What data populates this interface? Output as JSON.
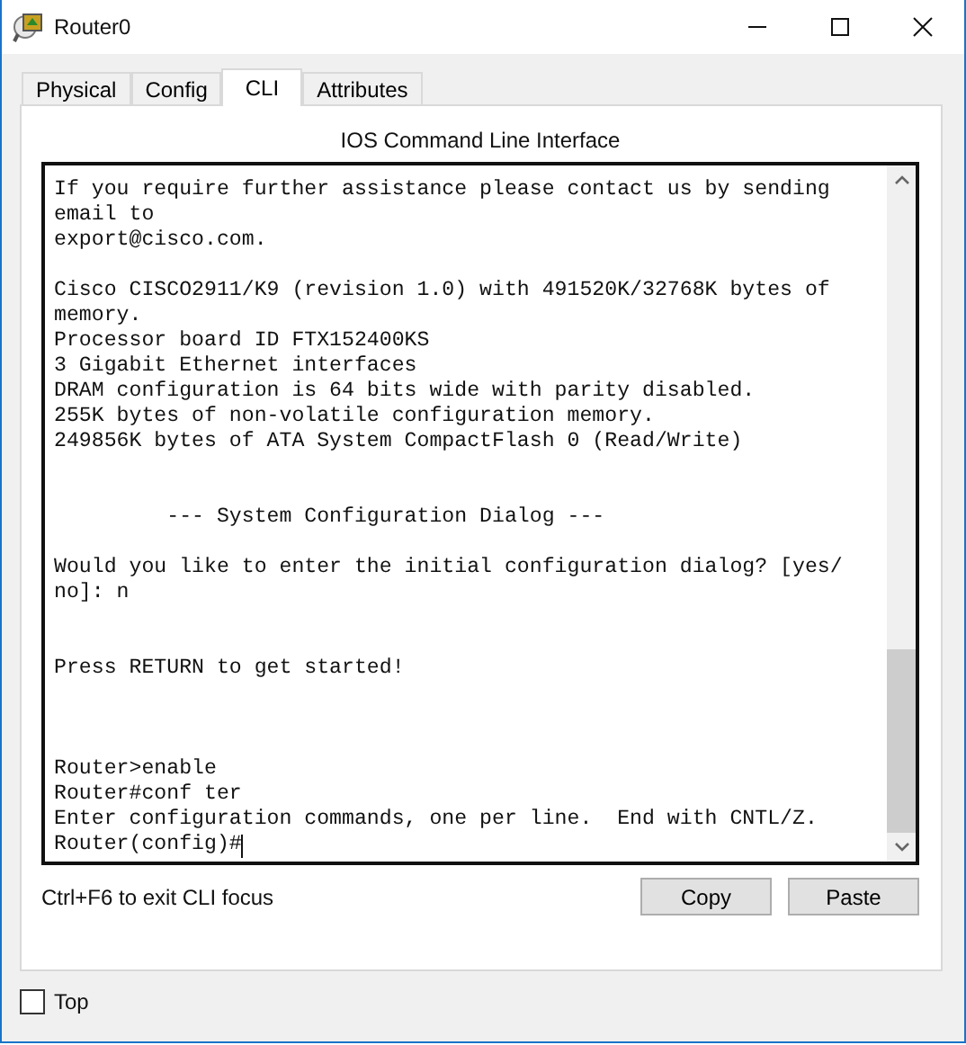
{
  "window": {
    "title": "Router0"
  },
  "tabs": [
    {
      "label": "Physical",
      "selected": false
    },
    {
      "label": "Config",
      "selected": false
    },
    {
      "label": "CLI",
      "selected": true
    },
    {
      "label": "Attributes",
      "selected": false
    }
  ],
  "heading": "IOS Command Line Interface",
  "terminal": {
    "output": "If you require further assistance please contact us by sending\nemail to\nexport@cisco.com.\n\nCisco CISCO2911/K9 (revision 1.0) with 491520K/32768K bytes of\nmemory.\nProcessor board ID FTX152400KS\n3 Gigabit Ethernet interfaces\nDRAM configuration is 64 bits wide with parity disabled.\n255K bytes of non-volatile configuration memory.\n249856K bytes of ATA System CompactFlash 0 (Read/Write)\n\n\n         --- System Configuration Dialog ---\n\nWould you like to enter the initial configuration dialog? [yes/\nno]: n\n\n\nPress RETURN to get started!\n\n\n\nRouter>enable\nRouter#conf ter\nEnter configuration commands, one per line.  End with CNTL/Z.",
    "prompt": "Router(config)#"
  },
  "hint": "Ctrl+F6 to exit CLI focus",
  "buttons": [
    "Copy",
    "Paste"
  ],
  "top_checkbox": {
    "label": "Top",
    "checked": false
  }
}
